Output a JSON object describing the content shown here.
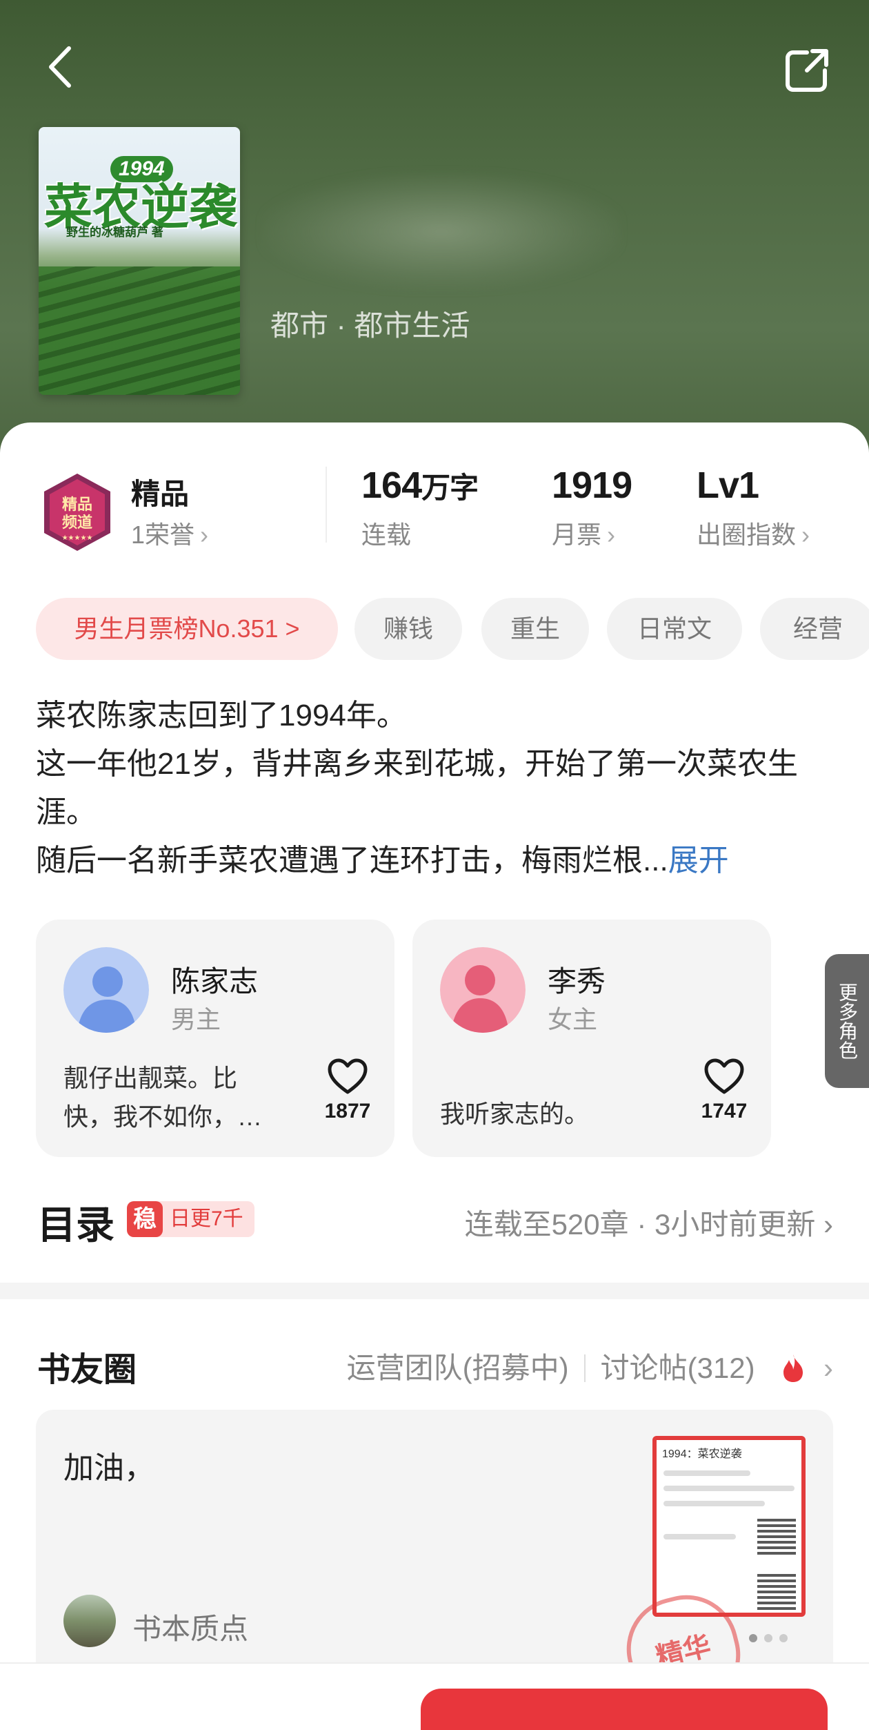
{
  "header": {
    "back_icon": "chevron-left-icon",
    "share_icon": "share-icon",
    "genre": "都市 · 都市生活"
  },
  "cover": {
    "badge": "1994",
    "title": "菜农逆袭",
    "subtitle": "野生的冰糖葫芦 著"
  },
  "stats": {
    "honor_title": "精品",
    "honor_sub": "1荣誉",
    "words_value": "164",
    "words_unit": "万字",
    "words_sub": "连载",
    "monthly_value": "1919",
    "monthly_sub": "月票",
    "level_value": "Lv1",
    "level_sub": "出圈指数",
    "chevron": "›"
  },
  "tags": [
    "男生月票榜No.351 >",
    "赚钱",
    "重生",
    "日常文",
    "经营"
  ],
  "synopsis": {
    "line1": "菜农陈家志回到了1994年。",
    "line2": "这一年他21岁，背井离乡来到花城，开始了第一次菜农生涯。",
    "line3": "随后一名新手菜农遭遇了连环打击，梅雨烂根...",
    "expand": "展开"
  },
  "roles": [
    {
      "name": "陈家志",
      "kind": "男主",
      "quote": "靓仔出靓菜。比快，我不如你，…",
      "likes": "1877",
      "color": "#8fb1ef"
    },
    {
      "name": "李秀",
      "kind": "女主",
      "quote": "我听家志的。",
      "likes": "1747",
      "color": "#f2869a"
    }
  ],
  "more_roles": "更多角色",
  "toc": {
    "title": "目录",
    "stable": "稳",
    "badge": "日更7千",
    "status": "连载至520章 · 3小时前更新 ›"
  },
  "circle": {
    "title": "书友圈",
    "team": "运营团队(招募中)",
    "posts": "讨论帖(312)",
    "fire_icon": "fire-icon",
    "chevron": "›"
  },
  "post": {
    "text": "加油，",
    "author": "书本质点",
    "stamp": "精华",
    "thumb_title": "1994：菜农逆袭"
  },
  "colors": {
    "accent": "#e8363c",
    "tag_rank_bg": "#fde7e7",
    "expand": "#3a78c4"
  }
}
